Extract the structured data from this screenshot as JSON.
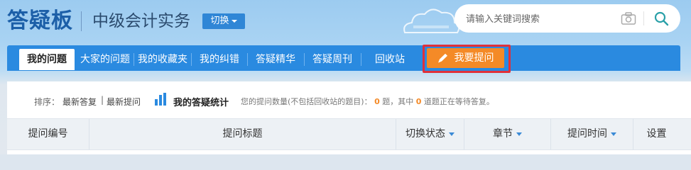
{
  "header": {
    "logo_text": "答疑板",
    "subject": "中级会计实务",
    "switch_label": "切换"
  },
  "search": {
    "placeholder": "请输入关键词搜索",
    "camera_icon": "camera-icon",
    "search_icon": "search-icon"
  },
  "nav": {
    "tabs": [
      {
        "label": "我的问题",
        "active": true
      },
      {
        "label": "大家的问题"
      },
      {
        "label": "我的收藏夹"
      },
      {
        "label": "我的纠错"
      },
      {
        "label": "答疑精华"
      },
      {
        "label": "答疑周刊"
      },
      {
        "label": "回收站"
      }
    ],
    "ask_label": "我要提问"
  },
  "sortbar": {
    "sort_label": "排序：",
    "option_latest_answer": "最新答复",
    "option_latest_question": "最新提问",
    "stats_title": "我的答疑统计",
    "stats_prefix": "您的提问数量(不包括回收站的题目)：",
    "question_count": "0",
    "stats_mid": "题，其中",
    "waiting_count": "0",
    "stats_suffix": "道题正在等待答复。"
  },
  "table": {
    "columns": [
      "提问编号",
      "提问标题",
      "切换状态",
      "章节",
      "提问时间",
      "设置"
    ]
  },
  "colors": {
    "brand_blue": "#2a8ae0",
    "accent_orange": "#f48a27",
    "highlight_red": "#e0303a"
  }
}
